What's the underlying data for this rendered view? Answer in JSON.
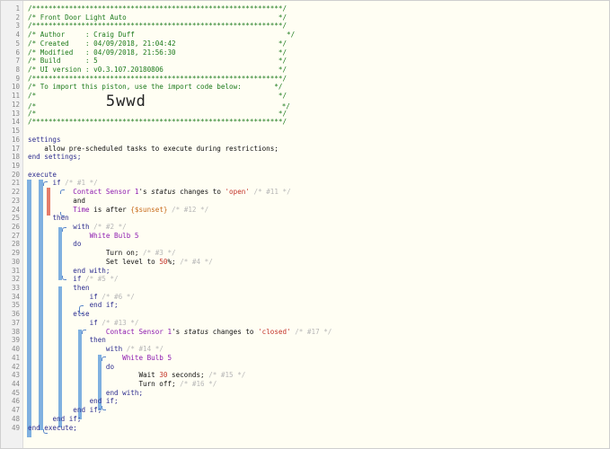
{
  "editor": {
    "lines": [
      [
        {
          "c": "c",
          "t": "/*************************************************************/"
        }
      ],
      [
        {
          "c": "c",
          "t": "/* Front Door Light Auto                                     */"
        }
      ],
      [
        {
          "c": "c",
          "t": "/*************************************************************/"
        }
      ],
      [
        {
          "c": "c",
          "t": "/* Author     : Craig Duff                                     */"
        }
      ],
      [
        {
          "c": "c",
          "t": "/* Created    : 04/09/2018, 21:04:42                         */"
        }
      ],
      [
        {
          "c": "c",
          "t": "/* Modified   : 04/09/2018, 21:56:30                         */"
        }
      ],
      [
        {
          "c": "c",
          "t": "/* Build      : 5                                            */"
        }
      ],
      [
        {
          "c": "c",
          "t": "/* UI version : v0.3.107.20180806                            */"
        }
      ],
      [
        {
          "c": "c",
          "t": "/*************************************************************/"
        }
      ],
      [
        {
          "c": "c",
          "t": "/* To import this piston, use the import code below:        */"
        }
      ],
      [
        {
          "c": "c",
          "t": "/*                                                           */"
        }
      ],
      [
        {
          "c": "c",
          "t": "/*                 "
        },
        {
          "c": "big",
          "t": "5wwd"
        },
        {
          "c": "c",
          "t": "                                 */"
        }
      ],
      [
        {
          "c": "c",
          "t": "/*                                                           */"
        }
      ],
      [
        {
          "c": "c",
          "t": "/*************************************************************/"
        }
      ],
      [],
      [
        {
          "c": "k",
          "t": "settings"
        }
      ],
      [
        {
          "c": "",
          "t": "    allow pre-scheduled tasks to execute during restrictions;"
        }
      ],
      [
        {
          "c": "k",
          "t": "end settings;"
        }
      ],
      [],
      [
        {
          "c": "k",
          "t": "execute"
        }
      ],
      [
        {
          "c": "",
          "t": "      "
        },
        {
          "c": "k",
          "t": "if"
        },
        {
          "c": "cm",
          "t": " /* #1 */"
        }
      ],
      [
        {
          "c": "",
          "t": "           "
        },
        {
          "c": "dev",
          "t": "Contact Sensor 1"
        },
        {
          "c": "",
          "t": "'s "
        },
        {
          "c": "attr",
          "t": "status"
        },
        {
          "c": "",
          "t": " changes to "
        },
        {
          "c": "str",
          "t": "'open'"
        },
        {
          "c": "cm",
          "t": " /* #11 */"
        }
      ],
      [
        {
          "c": "",
          "t": "           and"
        }
      ],
      [
        {
          "c": "",
          "t": "           "
        },
        {
          "c": "dev",
          "t": "Time"
        },
        {
          "c": "",
          "t": " is after "
        },
        {
          "c": "var",
          "t": "{$sunset}"
        },
        {
          "c": "cm",
          "t": " /* #12 */"
        }
      ],
      [
        {
          "c": "",
          "t": "      "
        },
        {
          "c": "k",
          "t": "then"
        }
      ],
      [
        {
          "c": "",
          "t": "           "
        },
        {
          "c": "k",
          "t": "with"
        },
        {
          "c": "cm",
          "t": " /* #2 */"
        }
      ],
      [
        {
          "c": "",
          "t": "               "
        },
        {
          "c": "dev",
          "t": "White Bulb 5"
        }
      ],
      [
        {
          "c": "",
          "t": "           "
        },
        {
          "c": "k",
          "t": "do"
        }
      ],
      [
        {
          "c": "",
          "t": "                   Turn on;"
        },
        {
          "c": "cm",
          "t": " /* #3 */"
        }
      ],
      [
        {
          "c": "",
          "t": "                   Set level to "
        },
        {
          "c": "num",
          "t": "50"
        },
        {
          "c": "",
          "t": "%;"
        },
        {
          "c": "cm",
          "t": " /* #4 */"
        }
      ],
      [
        {
          "c": "",
          "t": "           "
        },
        {
          "c": "k",
          "t": "end with;"
        }
      ],
      [
        {
          "c": "",
          "t": "           "
        },
        {
          "c": "k",
          "t": "if"
        },
        {
          "c": "cm",
          "t": " /* #5 */"
        }
      ],
      [
        {
          "c": "",
          "t": "           "
        },
        {
          "c": "k",
          "t": "then"
        }
      ],
      [
        {
          "c": "",
          "t": "               "
        },
        {
          "c": "k",
          "t": "if"
        },
        {
          "c": "cm",
          "t": " /* #6 */"
        }
      ],
      [
        {
          "c": "",
          "t": "               "
        },
        {
          "c": "k",
          "t": "end if;"
        }
      ],
      [
        {
          "c": "",
          "t": "           "
        },
        {
          "c": "k",
          "t": "else"
        }
      ],
      [
        {
          "c": "",
          "t": "               "
        },
        {
          "c": "k",
          "t": "if"
        },
        {
          "c": "cm",
          "t": " /* #13 */"
        }
      ],
      [
        {
          "c": "",
          "t": "                   "
        },
        {
          "c": "dev",
          "t": "Contact Sensor 1"
        },
        {
          "c": "",
          "t": "'s "
        },
        {
          "c": "attr",
          "t": "status"
        },
        {
          "c": "",
          "t": " changes to "
        },
        {
          "c": "str",
          "t": "'closed'"
        },
        {
          "c": "cm",
          "t": " /* #17 */"
        }
      ],
      [
        {
          "c": "",
          "t": "               "
        },
        {
          "c": "k",
          "t": "then"
        }
      ],
      [
        {
          "c": "",
          "t": "                   "
        },
        {
          "c": "k",
          "t": "with"
        },
        {
          "c": "cm",
          "t": " /* #14 */"
        }
      ],
      [
        {
          "c": "",
          "t": "                       "
        },
        {
          "c": "dev",
          "t": "White Bulb 5"
        }
      ],
      [
        {
          "c": "",
          "t": "                   "
        },
        {
          "c": "k",
          "t": "do"
        }
      ],
      [
        {
          "c": "",
          "t": "                           Wait "
        },
        {
          "c": "num",
          "t": "30"
        },
        {
          "c": "",
          "t": " seconds;"
        },
        {
          "c": "cm",
          "t": " /* #15 */"
        }
      ],
      [
        {
          "c": "",
          "t": "                           Turn off;"
        },
        {
          "c": "cm",
          "t": " /* #16 */"
        }
      ],
      [
        {
          "c": "",
          "t": "                   "
        },
        {
          "c": "k",
          "t": "end with;"
        }
      ],
      [
        {
          "c": "",
          "t": "               "
        },
        {
          "c": "k",
          "t": "end if;"
        }
      ],
      [
        {
          "c": "",
          "t": "           "
        },
        {
          "c": "k",
          "t": "end if;"
        }
      ],
      [
        {
          "c": "",
          "t": "      "
        },
        {
          "c": "k",
          "t": "end if;"
        }
      ],
      [
        {
          "c": "k",
          "t": "end execute;"
        }
      ]
    ]
  }
}
